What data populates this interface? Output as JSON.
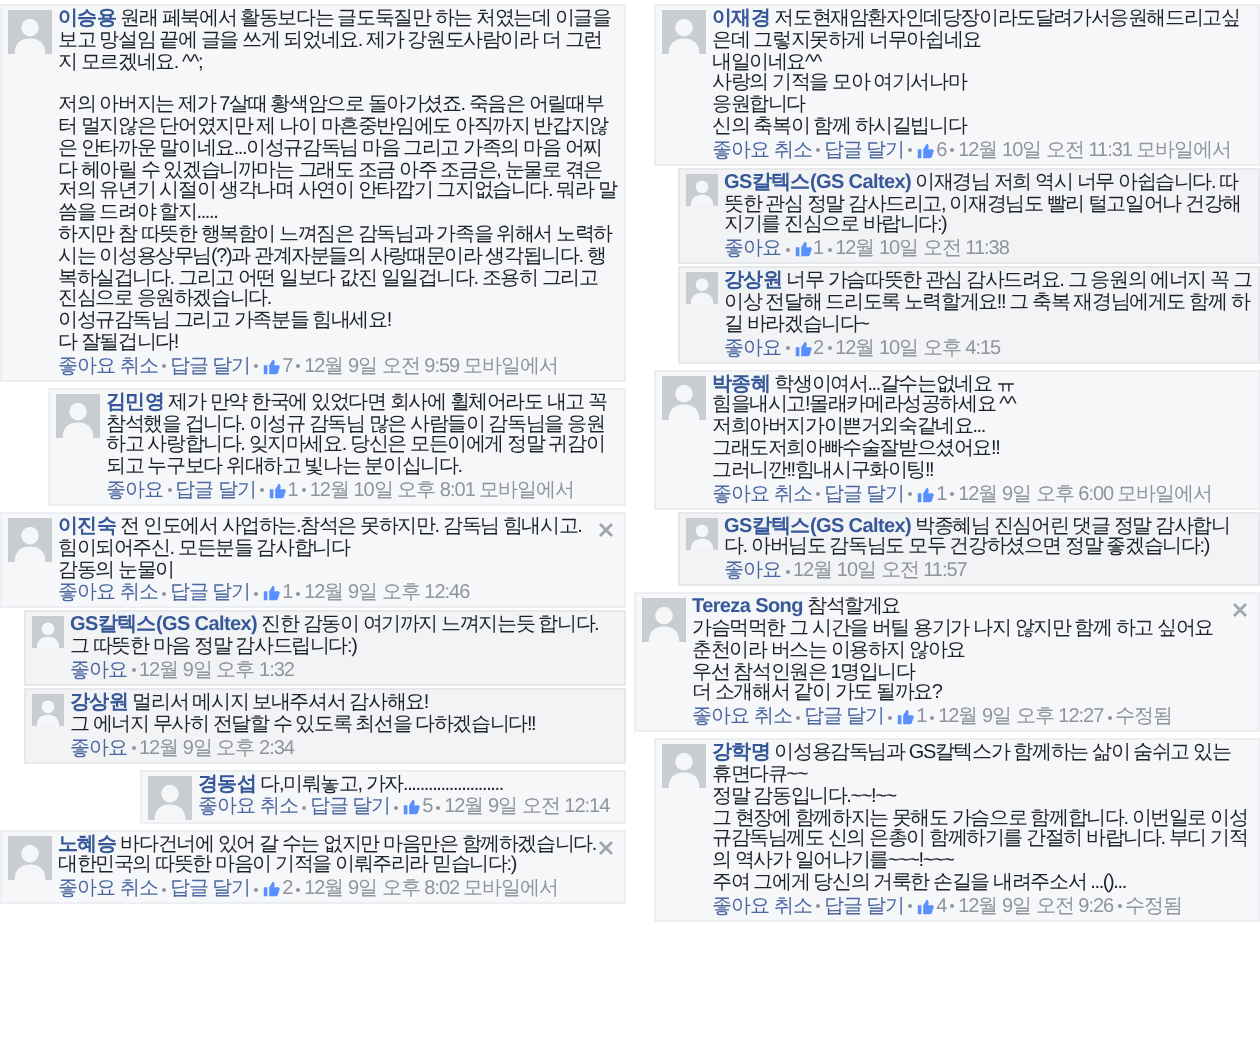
{
  "columns": [
    {
      "comments": [
        {
          "author": "이승용",
          "text": "원래 페북에서 활동보다는 글도둑질만 하는 처였는데 이글을 보고 망설임 끝에 글을 쓰게 되었네요. 제가 강원도사람이라 더 그런지 모르겠네요. ^^;\n\n저의 아버지는 제가 7살때 황색암으로 돌아가셨죠. 죽음은 어릴때부터 멀지않은 단어였지만 제 나이 마흔중반임에도 아직까지 반갑지않은 안타까운 말이네요...이성규감독님 마음 그리고 가족의 마음 어찌 다 헤아릴 수 있겠습니까마는 그래도 조금 아주 조금은, 눈물로 겪은 저의 유년기 시절이 생각나며 사연이 안타깝기 그지없습니다. 뭐라 말씀을 드려야 할지.....\n하지만 참 따뜻한 행복함이 느껴짐은 감독님과 가족을 위해서 노력하시는 이성용상무님(?)과 관계자분들의 사랑때문이라 생각됩니다. 행복하실겁니다. 그리고 어떤 일보다 값진 일일겁니다. 조용히 그리고 진심으로 응원하겠습니다.\n이성규감독님 그리고 가족분들 힘내세요!\n다 잘될겁니다!",
          "actions": [
            "좋아요 취소",
            "답글 달기"
          ],
          "likes": "7",
          "time": "12월 9일 오전 9:59",
          "via": "모바일에서",
          "closable": false
        },
        {
          "author": "김민영",
          "text": "제가 만약 한국에 있었다면 회사에 휠체어라도 내고 꼭 참석했을 겁니다. 이성규 감독님 많은 사람들이 감독님을 응원하고 사랑합니다. 잊지마세요. 당신은 모든이에게 정말 귀감이 되고 누구보다 위대하고 빛나는 분이십니다.",
          "actions": [
            "좋아요",
            "답글 달기"
          ],
          "likes": "1",
          "time": "12월 10일 오후 8:01",
          "via": "모바일에서",
          "closable": false
        },
        {
          "author": "이진숙",
          "text": "전 인도에서 사업하는.참석은 못하지만. 감독님 힘내시고. 힘이되어주신. 모든분들 감사합니다\n감동의 눈물이",
          "actions": [
            "좋아요 취소",
            "답글 달기"
          ],
          "likes": "1",
          "time": "12월 9일 오후 12:46",
          "closable": true,
          "replies": [
            {
              "author": "GS칼텍스(GS Caltex)",
              "text": "진한 감동이 여기까지 느껴지는듯 합니다. 그 따뜻한 마음 정말 감사드립니다:)",
              "actions": [
                "좋아요"
              ],
              "time": "12월 9일 오후 1:32"
            },
            {
              "author": "강상원",
              "text": "멀리서 메시지 보내주셔서 감사해요!\n그 에너지 무사히 전달할 수 있도록 최선을 다하겠습니다!!",
              "actions": [
                "좋아요"
              ],
              "time": "12월 9일 오후 2:34"
            }
          ]
        },
        {
          "author": "경동섭",
          "text": "다,미뤄놓고, 가자........................",
          "actions": [
            "좋아요 취소",
            "답글 달기"
          ],
          "likes": "5",
          "time": "12월 9일 오전 12:14",
          "closable": false
        },
        {
          "author": "노혜승",
          "text": "바다건너에 있어 갈 수는 없지만 마음만은 함께하겠습니다. 대한민국의 따뜻한 마음이 기적을 이뤄주리라 믿습니다:)",
          "actions": [
            "좋아요 취소",
            "답글 달기"
          ],
          "likes": "2",
          "time": "12월 9일 오후 8:02",
          "via": "모바일에서",
          "closable": true
        }
      ]
    },
    {
      "comments": [
        {
          "author": "이재경",
          "text": "저도현재암환자인데당장이라도달려가서응원해드리고싶은데 그렇지못하게 너무아쉽네요\n내일이네요^^\n사랑의 기적을 모아 여기서나마\n응원합니다\n신의 축복이 함께 하시길빕니다",
          "actions": [
            "좋아요 취소",
            "답글 달기"
          ],
          "likes": "6",
          "time": "12월 10일 오전 11:31",
          "via": "모바일에서",
          "closable": false,
          "replies": [
            {
              "author": "GS칼텍스(GS Caltex)",
              "text": "이재경님 저희 역시 너무 아쉽습니다. 따뜻한 관심 정말 감사드리고, 이재경님도 빨리 털고일어나 건강해지기를 진심으로 바랍니다:)",
              "actions": [
                "좋아요"
              ],
              "likes": "1",
              "time": "12월 10일 오전 11:38"
            },
            {
              "author": "강상원",
              "text": "너무 가슴따뜻한 관심 감사드려요. 그 응원의 에너지 꼭 그 이상 전달해 드리도록 노력할게요!! 그 축복 재경님에게도 함께 하길 바라겠습니다~",
              "actions": [
                "좋아요"
              ],
              "likes": "2",
              "time": "12월 10일 오후 4:15"
            }
          ]
        },
        {
          "author": "박종혜",
          "text": "학생이여서...갈수는없네요 ㅠ\n힘을내시고!몰래카메라성공하세요 ^^\n저희아버지가이쁜거외숙같네요...\n그래도저희아빠수술잘받으셨어요!!\n그러니깐!!힘내시구화이팅!!",
          "actions": [
            "좋아요 취소",
            "답글 달기"
          ],
          "likes": "1",
          "time": "12월 9일 오후 6:00",
          "via": "모바일에서",
          "closable": false,
          "replies": [
            {
              "author": "GS칼텍스(GS Caltex)",
              "text": "박종혜님 진심어린 댓글 정말 감사합니다. 아버님도 감독님도 모두 건강하셨으면 정말 좋겠습니다:)",
              "actions": [
                "좋아요"
              ],
              "time": "12월 10일 오전 11:57"
            }
          ]
        },
        {
          "author": "Tereza Song",
          "text": "참석할게요\n가슴먹먹한 그 시간을 버틸 용기가 나지 않지만 함께 하고 싶어요\n춘천이라 버스는 이용하지 않아요\n우선 참석인원은 1명입니다\n더 소개해서 같이 가도 될까요?",
          "actions": [
            "좋아요 취소",
            "답글 달기"
          ],
          "likes": "1",
          "time": "12월 9일 오후 12:27",
          "edited": "수정됨",
          "closable": true
        },
        {
          "author": "강학명",
          "text": "이성용감독님과 GS칼텍스가 함께하는 삶이 숨쉬고 있는 휴면다큐~~\n정말 감동입니다.~~!~~\n그 현장에 함께하지는 못해도 가슴으로 함께합니다. 이번일로 이성규감독님께도 신의 은총이 함께하기를 간절히 바랍니다. 부디 기적의 역사가 일어나기를~~~!~~~\n주여 그에게 당신의 거룩한 손길을 내려주소서 ...()...",
          "actions": [
            "좋아요 취소",
            "답글 달기"
          ],
          "likes": "4",
          "time": "12월 9일 오전 9:26",
          "edited": "수정됨",
          "closable": false
        }
      ]
    }
  ]
}
